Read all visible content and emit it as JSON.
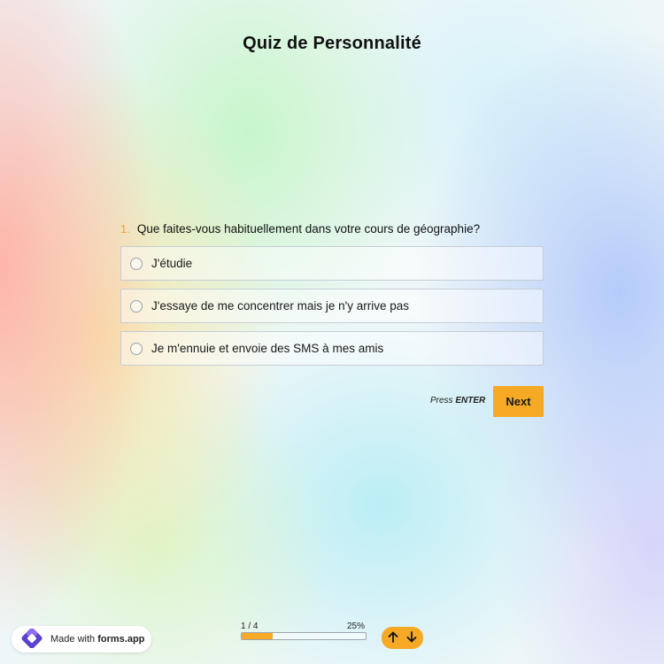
{
  "title": "Quiz de Personnalité",
  "question": {
    "number": "1.",
    "text": "Que faites-vous habituellement dans votre cours de géographie?",
    "options": [
      "J'étudie",
      "J'essaye de me concentrer mais je n'y arrive pas",
      "Je m'ennuie et envoie des SMS à mes amis"
    ]
  },
  "actions": {
    "press_prefix": "Press ",
    "press_key": "ENTER",
    "next_label": "Next"
  },
  "footer": {
    "made_with_prefix": "Made with ",
    "brand": "forms.app",
    "progress_count": "1 / 4",
    "progress_percent": "25%",
    "progress_value": 0.25
  },
  "icons": {
    "logo": "forms-app-logo-icon",
    "up": "arrow-up-icon",
    "down": "arrow-down-icon",
    "radio": "radio-unchecked-icon"
  },
  "colors": {
    "accent": "#f5a925",
    "question_number": "#e9a43a",
    "brand_purple": "#6a4bd6"
  }
}
